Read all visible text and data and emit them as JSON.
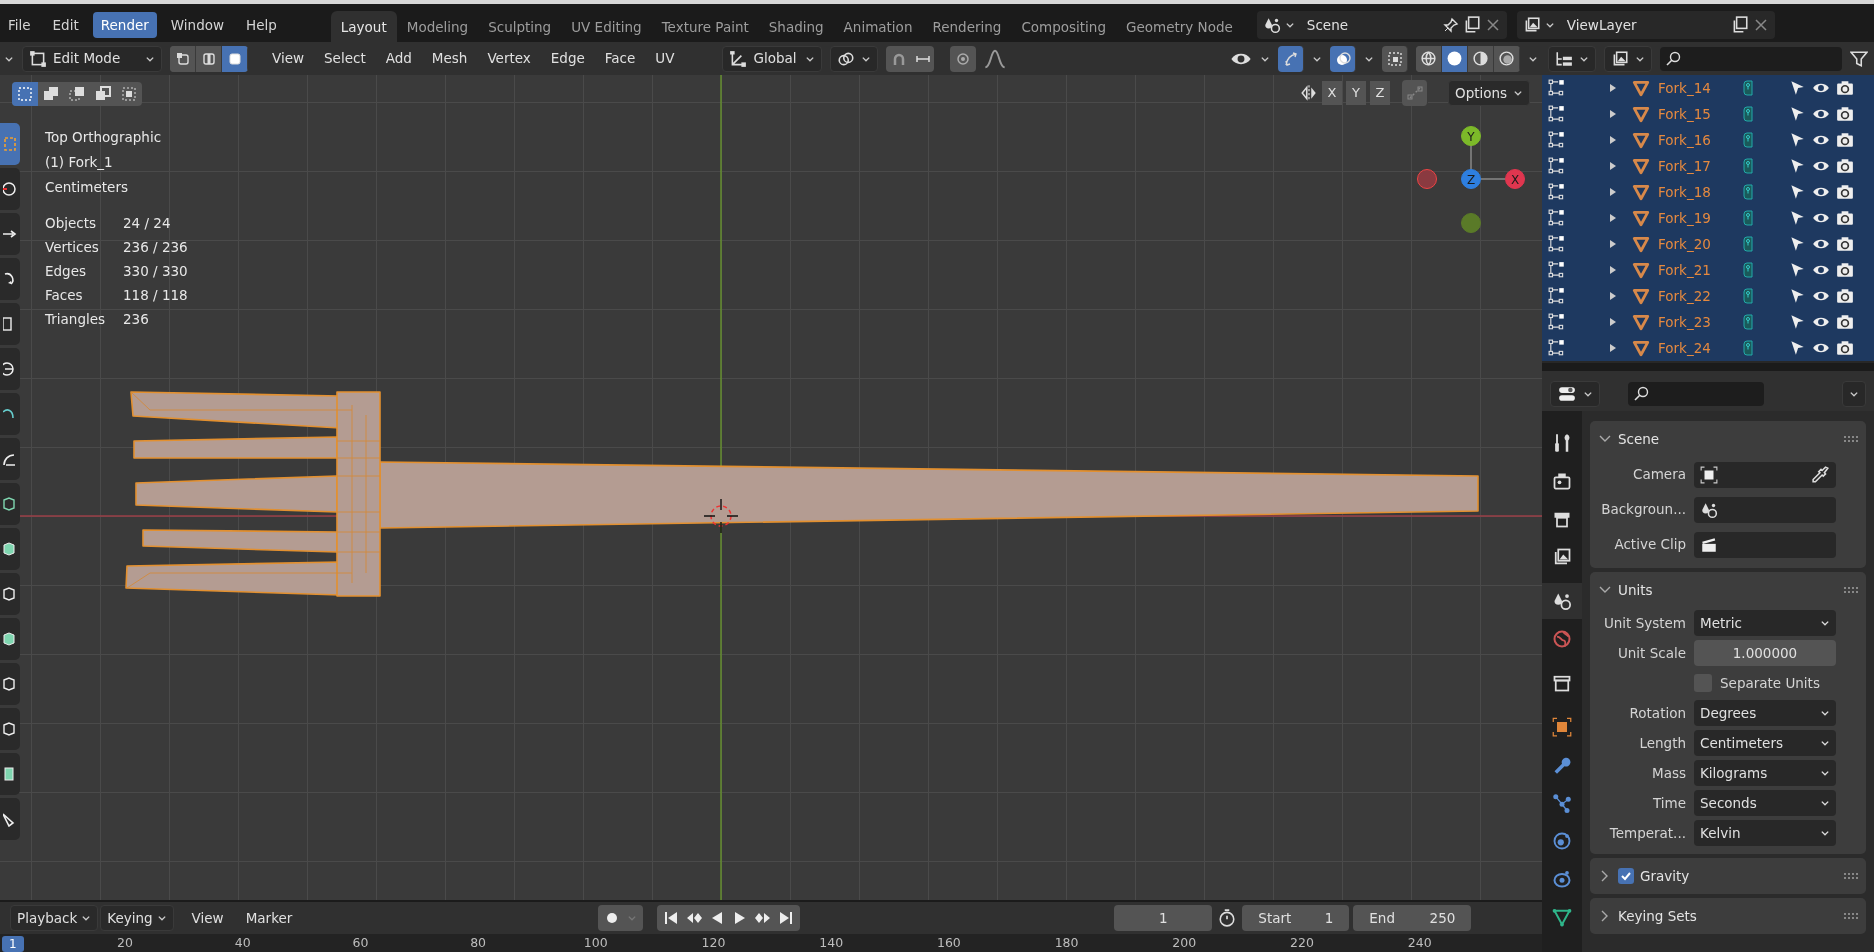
{
  "menu": [
    {
      "label": "File",
      "selected": false
    },
    {
      "label": "Edit",
      "selected": false
    },
    {
      "label": "Render",
      "selected": true
    },
    {
      "label": "Window",
      "selected": false
    },
    {
      "label": "Help",
      "selected": false
    }
  ],
  "workspaces": [
    {
      "label": "Layout",
      "selected": true
    },
    {
      "label": "Modeling",
      "selected": false
    },
    {
      "label": "Sculpting",
      "selected": false
    },
    {
      "label": "UV Editing",
      "selected": false
    },
    {
      "label": "Texture Paint",
      "selected": false
    },
    {
      "label": "Shading",
      "selected": false
    },
    {
      "label": "Animation",
      "selected": false
    },
    {
      "label": "Rendering",
      "selected": false
    },
    {
      "label": "Compositing",
      "selected": false
    },
    {
      "label": "Geometry Node",
      "selected": false
    }
  ],
  "scene": {
    "value": "Scene"
  },
  "view_layer": {
    "value": "ViewLayer"
  },
  "viewport_header": {
    "mode": "Edit Mode",
    "select_modes": [
      {
        "kind": "vertex",
        "selected": false
      },
      {
        "kind": "edge",
        "selected": false
      },
      {
        "kind": "face",
        "selected": true
      }
    ],
    "menus": [
      "View",
      "Select",
      "Add",
      "Mesh",
      "Vertex",
      "Edge",
      "Face",
      "UV"
    ],
    "orientation": "Global",
    "gizmos_on": true,
    "overlays_on": true,
    "shading": [
      {
        "kind": "wireframe",
        "selected": false
      },
      {
        "kind": "solid",
        "selected": true
      },
      {
        "kind": "material",
        "selected": false
      },
      {
        "kind": "rendered",
        "selected": false
      }
    ]
  },
  "viewport": {
    "tools": [
      {
        "kind": "select",
        "selected": true
      },
      {
        "kind": "cursor",
        "selected": false
      },
      {
        "kind": "move",
        "selected": false
      },
      {
        "kind": "rotate",
        "selected": false
      },
      {
        "kind": "scale",
        "selected": false
      },
      {
        "kind": "transform",
        "selected": false
      },
      {
        "kind": "annotate",
        "selected": false
      },
      {
        "kind": "measure",
        "selected": false
      },
      {
        "kind": "add-cube",
        "selected": false
      },
      {
        "kind": "extrude",
        "selected": false
      },
      {
        "kind": "inset",
        "selected": false
      },
      {
        "kind": "bevel",
        "selected": false
      },
      {
        "kind": "loop-cut",
        "selected": false
      },
      {
        "kind": "knife",
        "selected": false
      },
      {
        "kind": "poly-build",
        "selected": false
      },
      {
        "kind": "shear",
        "selected": false
      }
    ],
    "box_modes": [
      {
        "selected": true
      },
      {
        "selected": false
      },
      {
        "selected": false
      },
      {
        "selected": false
      },
      {
        "selected": false
      }
    ],
    "axis_buttons": [
      "X",
      "Y",
      "Z"
    ],
    "options": "Options",
    "info": [
      "Top Orthographic",
      "(1) Fork_1",
      "Centimeters"
    ],
    "stats": [
      {
        "label": "Objects",
        "value": "24 / 24"
      },
      {
        "label": "Vertices",
        "value": "236 / 236"
      },
      {
        "label": "Edges",
        "value": "330 / 330"
      },
      {
        "label": "Faces",
        "value": "118 / 118"
      },
      {
        "label": "Triangles",
        "value": "236"
      }
    ],
    "gizmo": {
      "y": "Y",
      "z": "Z",
      "x": "X"
    }
  },
  "outliner": {
    "rows": [
      {
        "name": "Fork_14",
        "selected": true
      },
      {
        "name": "Fork_15",
        "selected": true
      },
      {
        "name": "Fork_16",
        "selected": true
      },
      {
        "name": "Fork_17",
        "selected": true
      },
      {
        "name": "Fork_18",
        "selected": true
      },
      {
        "name": "Fork_19",
        "selected": true
      },
      {
        "name": "Fork_20",
        "selected": true
      },
      {
        "name": "Fork_21",
        "selected": true
      },
      {
        "name": "Fork_22",
        "selected": true
      },
      {
        "name": "Fork_23",
        "selected": true
      },
      {
        "name": "Fork_24",
        "selected": true
      }
    ]
  },
  "properties": {
    "tabs": [
      {
        "kind": "tool",
        "selected": false
      },
      {
        "kind": "render",
        "selected": false
      },
      {
        "kind": "output",
        "selected": false
      },
      {
        "kind": "view_layer",
        "selected": false
      },
      {
        "kind": "scene",
        "selected": true
      },
      {
        "kind": "world",
        "selected": false
      },
      {
        "kind": "collection",
        "selected": false
      },
      {
        "kind": "object",
        "selected": false
      },
      {
        "kind": "modifier",
        "selected": false
      },
      {
        "kind": "particles",
        "selected": false
      },
      {
        "kind": "physics",
        "selected": false
      },
      {
        "kind": "constraints",
        "selected": false
      },
      {
        "kind": "data",
        "selected": false
      }
    ],
    "panels": [
      {
        "title": "Scene",
        "expanded": true,
        "rows": [
          {
            "kind": "camera",
            "label": "Camera"
          },
          {
            "kind": "background",
            "label": "Backgroun..."
          },
          {
            "kind": "clip",
            "label": "Active Clip"
          }
        ]
      },
      {
        "title": "Units",
        "expanded": true,
        "rows": [
          {
            "kind": "dropdown",
            "label": "Unit System",
            "value": "Metric"
          },
          {
            "kind": "number",
            "label": "Unit Scale",
            "value": "1.000000"
          },
          {
            "kind": "checkbox",
            "label": "Separate Units",
            "checked": false
          },
          {
            "kind": "dropdown",
            "label": "Rotation",
            "value": "Degrees"
          },
          {
            "kind": "dropdown",
            "label": "Length",
            "value": "Centimeters"
          },
          {
            "kind": "dropdown",
            "label": "Mass",
            "value": "Kilograms"
          },
          {
            "kind": "dropdown",
            "label": "Time",
            "value": "Seconds"
          },
          {
            "kind": "dropdown",
            "label": "Temperat...",
            "value": "Kelvin"
          }
        ]
      },
      {
        "title": "Gravity",
        "expanded": false,
        "checked": true
      },
      {
        "title": "Keying Sets",
        "expanded": false
      }
    ]
  },
  "timeline": {
    "menus": [
      {
        "kind": "dropdown",
        "label": "Playback"
      },
      {
        "kind": "dropdown",
        "label": "Keying"
      },
      {
        "kind": "menu",
        "label": "View"
      },
      {
        "kind": "menu",
        "label": "Marker"
      }
    ],
    "auto_keying": false,
    "frame": "1",
    "start_label": "Start",
    "start": "1",
    "end_label": "End",
    "end": "250",
    "ruler": {
      "current": "1",
      "ticks": [
        "20",
        "40",
        "60",
        "80",
        "100",
        "120",
        "140",
        "160",
        "180",
        "200",
        "220",
        "240"
      ]
    }
  }
}
